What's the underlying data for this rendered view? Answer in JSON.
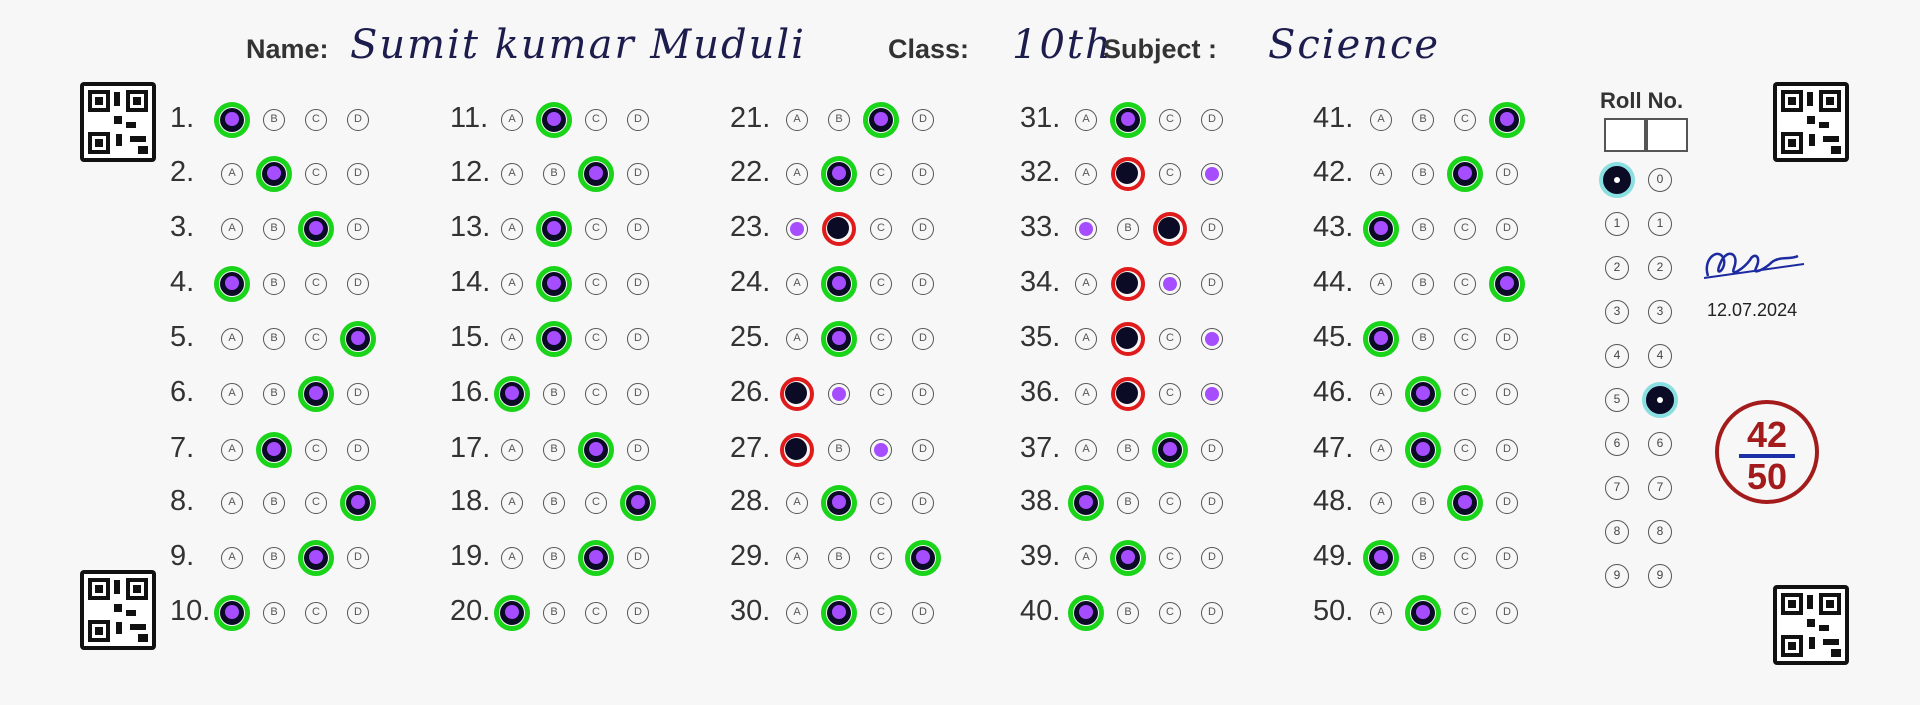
{
  "header": {
    "name_label": "Name:",
    "name_value": "Sumit kumar Muduli",
    "class_label": "Class:",
    "class_value": "10th",
    "subject_label": "Subject :",
    "subject_value": "Science"
  },
  "options": [
    "A",
    "B",
    "C",
    "D"
  ],
  "questions": [
    {
      "n": "1.",
      "marked": "A",
      "correct": "A",
      "result": "correct"
    },
    {
      "n": "2.",
      "marked": "B",
      "correct": "B",
      "result": "correct"
    },
    {
      "n": "3.",
      "marked": "C",
      "correct": "C",
      "result": "correct"
    },
    {
      "n": "4.",
      "marked": "A",
      "correct": "A",
      "result": "correct"
    },
    {
      "n": "5.",
      "marked": "D",
      "correct": "D",
      "result": "correct"
    },
    {
      "n": "6.",
      "marked": "C",
      "correct": "C",
      "result": "correct"
    },
    {
      "n": "7.",
      "marked": "B",
      "correct": "B",
      "result": "correct"
    },
    {
      "n": "8.",
      "marked": "D",
      "correct": "D",
      "result": "correct"
    },
    {
      "n": "9.",
      "marked": "C",
      "correct": "C",
      "result": "correct"
    },
    {
      "n": "10.",
      "marked": "A",
      "correct": "A",
      "result": "correct"
    },
    {
      "n": "11.",
      "marked": "B",
      "correct": "B",
      "result": "correct"
    },
    {
      "n": "12.",
      "marked": "C",
      "correct": "C",
      "result": "correct"
    },
    {
      "n": "13.",
      "marked": "B",
      "correct": "B",
      "result": "correct"
    },
    {
      "n": "14.",
      "marked": "B",
      "correct": "B",
      "result": "correct"
    },
    {
      "n": "15.",
      "marked": "B",
      "correct": "B",
      "result": "correct"
    },
    {
      "n": "16.",
      "marked": "A",
      "correct": "A",
      "result": "correct"
    },
    {
      "n": "17.",
      "marked": "C",
      "correct": "C",
      "result": "correct"
    },
    {
      "n": "18.",
      "marked": "D",
      "correct": "D",
      "result": "correct"
    },
    {
      "n": "19.",
      "marked": "C",
      "correct": "C",
      "result": "correct"
    },
    {
      "n": "20.",
      "marked": "A",
      "correct": "A",
      "result": "correct"
    },
    {
      "n": "21.",
      "marked": "C",
      "correct": "C",
      "result": "correct"
    },
    {
      "n": "22.",
      "marked": "B",
      "correct": "B",
      "result": "correct"
    },
    {
      "n": "23.",
      "marked": "B",
      "correct": "A",
      "result": "wrong"
    },
    {
      "n": "24.",
      "marked": "B",
      "correct": "B",
      "result": "correct"
    },
    {
      "n": "25.",
      "marked": "B",
      "correct": "B",
      "result": "correct"
    },
    {
      "n": "26.",
      "marked": "A",
      "correct": "B",
      "result": "wrong"
    },
    {
      "n": "27.",
      "marked": "A",
      "correct": "C",
      "result": "wrong"
    },
    {
      "n": "28.",
      "marked": "B",
      "correct": "B",
      "result": "correct"
    },
    {
      "n": "29.",
      "marked": "D",
      "correct": "D",
      "result": "correct"
    },
    {
      "n": "30.",
      "marked": "B",
      "correct": "B",
      "result": "correct"
    },
    {
      "n": "31.",
      "marked": "B",
      "correct": "B",
      "result": "correct"
    },
    {
      "n": "32.",
      "marked": "B",
      "correct": "D",
      "result": "wrong"
    },
    {
      "n": "33.",
      "marked": "C",
      "correct": "A",
      "result": "wrong"
    },
    {
      "n": "34.",
      "marked": "B",
      "correct": "C",
      "result": "wrong"
    },
    {
      "n": "35.",
      "marked": "B",
      "correct": "D",
      "result": "wrong"
    },
    {
      "n": "36.",
      "marked": "B",
      "correct": "D",
      "result": "wrong"
    },
    {
      "n": "37.",
      "marked": "C",
      "correct": "C",
      "result": "correct"
    },
    {
      "n": "38.",
      "marked": "A",
      "correct": "A",
      "result": "correct"
    },
    {
      "n": "39.",
      "marked": "B",
      "correct": "B",
      "result": "correct"
    },
    {
      "n": "40.",
      "marked": "A",
      "correct": "A",
      "result": "correct"
    },
    {
      "n": "41.",
      "marked": "D",
      "correct": "D",
      "result": "correct"
    },
    {
      "n": "42.",
      "marked": "C",
      "correct": "C",
      "result": "correct"
    },
    {
      "n": "43.",
      "marked": "A",
      "correct": "A",
      "result": "correct"
    },
    {
      "n": "44.",
      "marked": "D",
      "correct": "D",
      "result": "correct"
    },
    {
      "n": "45.",
      "marked": "A",
      "correct": "A",
      "result": "correct"
    },
    {
      "n": "46.",
      "marked": "B",
      "correct": "B",
      "result": "correct"
    },
    {
      "n": "47.",
      "marked": "B",
      "correct": "B",
      "result": "correct"
    },
    {
      "n": "48.",
      "marked": "C",
      "correct": "C",
      "result": "correct"
    },
    {
      "n": "49.",
      "marked": "A",
      "correct": "A",
      "result": "correct"
    },
    {
      "n": "50.",
      "marked": "B",
      "correct": "B",
      "result": "correct"
    }
  ],
  "roll": {
    "title": "Roll No.",
    "digits": [
      "0",
      "1",
      "2",
      "3",
      "4",
      "5",
      "6",
      "7",
      "8",
      "9"
    ],
    "selected": {
      "column1": "0",
      "column2": "5"
    }
  },
  "signature": {
    "date": "12.07.2024"
  },
  "score": {
    "obtained": "42",
    "total": "50"
  },
  "colors": {
    "correct_ring": "#19d419",
    "wrong_ring": "#e01b1b",
    "answer_key_mark": "#a64dff",
    "student_mark": "#0b0b25",
    "score_ink": "#a31b1b"
  },
  "icons": [
    "qr-code-icon",
    "signature-icon"
  ]
}
